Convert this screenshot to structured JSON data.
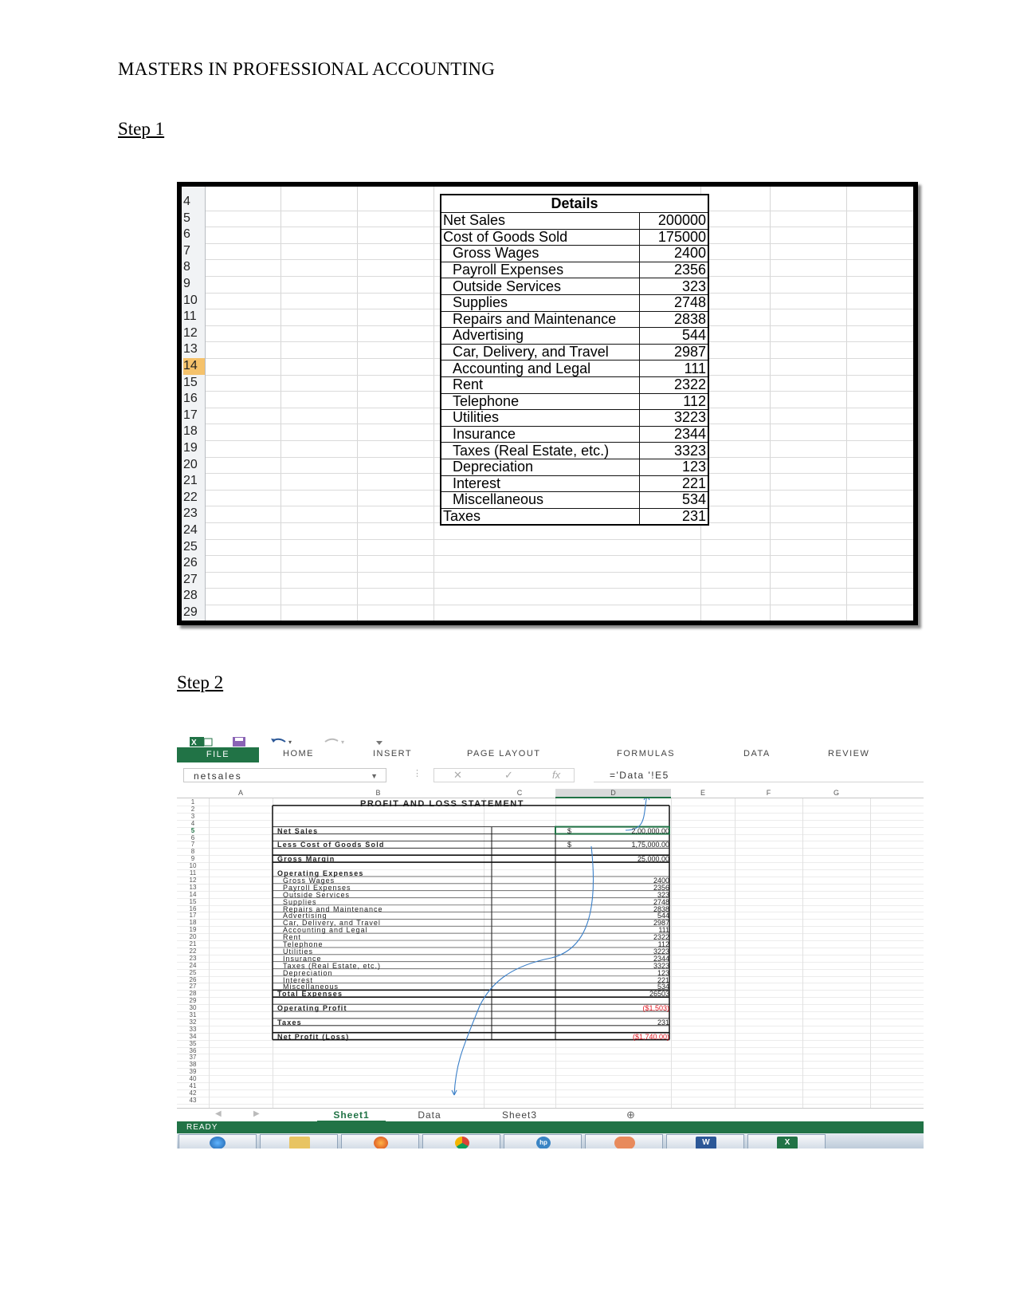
{
  "document": {
    "header": "MASTERS IN PROFESSIONAL ACCOUNTING",
    "step1_label": "Step 1",
    "step2_label": "Step 2"
  },
  "screenshot1": {
    "row_numbers": [
      "4",
      "5",
      "6",
      "7",
      "8",
      "9",
      "10",
      "11",
      "12",
      "13",
      "14",
      "15",
      "16",
      "17",
      "18",
      "19",
      "20",
      "21",
      "22",
      "23",
      "24",
      "25",
      "26",
      "27",
      "28",
      "29"
    ],
    "selected_row": "14",
    "table_header": "Details",
    "rows": [
      {
        "label": "Net Sales",
        "value": "200000",
        "indent": false
      },
      {
        "label": "Cost of Goods Sold",
        "value": "175000",
        "indent": false
      },
      {
        "label": "Gross Wages",
        "value": "2400",
        "indent": true
      },
      {
        "label": "Payroll Expenses",
        "value": "2356",
        "indent": true
      },
      {
        "label": "Outside Services",
        "value": "323",
        "indent": true
      },
      {
        "label": "Supplies",
        "value": "2748",
        "indent": true
      },
      {
        "label": "Repairs and Maintenance",
        "value": "2838",
        "indent": true
      },
      {
        "label": "Advertising",
        "value": "544",
        "indent": true
      },
      {
        "label": "Car, Delivery, and Travel",
        "value": "2987",
        "indent": true
      },
      {
        "label": "Accounting and Legal",
        "value": "111",
        "indent": true
      },
      {
        "label": "Rent",
        "value": "2322",
        "indent": true
      },
      {
        "label": "Telephone",
        "value": "112",
        "indent": true
      },
      {
        "label": "Utilities",
        "value": "3223",
        "indent": true
      },
      {
        "label": "Insurance",
        "value": "2344",
        "indent": true
      },
      {
        "label": "Taxes (Real Estate, etc.)",
        "value": "3323",
        "indent": true
      },
      {
        "label": "Depreciation",
        "value": "123",
        "indent": true
      },
      {
        "label": "Interest",
        "value": "221",
        "indent": true
      },
      {
        "label": "Miscellaneous",
        "value": "534",
        "indent": true
      },
      {
        "label": "Taxes",
        "value": "231",
        "indent": false
      }
    ]
  },
  "screenshot2": {
    "ribbon_tabs": [
      "FILE",
      "HOME",
      "INSERT",
      "PAGE LAYOUT",
      "FORMULAS",
      "DATA",
      "REVIEW"
    ],
    "name_box": "netsales",
    "formula": "='Data '!E5",
    "fx_symbol": "fx",
    "columns": [
      "A",
      "B",
      "C",
      "D",
      "E",
      "F",
      "G"
    ],
    "selected_column": "D",
    "title": "PROFIT AND LOSS STATEMENT",
    "net_sales": {
      "label": "Net Sales",
      "currency": "$",
      "value": "2,00,000.00"
    },
    "cogs": {
      "label": "Less Cost of Goods Sold",
      "currency": "$",
      "value": "1,75,000.00"
    },
    "gross_margin": {
      "label": "Gross Margin",
      "value": "25,000.00"
    },
    "opex_heading": "Operating Expenses",
    "expenses": [
      {
        "label": "Gross Wages",
        "value": "2400"
      },
      {
        "label": "Payroll Expenses",
        "value": "2356"
      },
      {
        "label": "Outside Services",
        "value": "323"
      },
      {
        "label": "Supplies",
        "value": "2748"
      },
      {
        "label": "Repairs and Maintenance",
        "value": "2838"
      },
      {
        "label": "Advertising",
        "value": "544"
      },
      {
        "label": "Car, Delivery, and Travel",
        "value": "2987"
      },
      {
        "label": "Accounting and Legal",
        "value": "111"
      },
      {
        "label": "Rent",
        "value": "2322"
      },
      {
        "label": "Telephone",
        "value": "112"
      },
      {
        "label": "Utilities",
        "value": "3223"
      },
      {
        "label": "Insurance",
        "value": "2344"
      },
      {
        "label": "Taxes (Real Estate, etc.)",
        "value": "3323"
      },
      {
        "label": "Depreciation",
        "value": "123"
      },
      {
        "label": "Interest",
        "value": "221"
      },
      {
        "label": "Miscellaneous",
        "value": "534"
      }
    ],
    "total_expenses": {
      "label": "Total Expenses",
      "value": "26503"
    },
    "operating_profit": {
      "label": "Operating Profit",
      "value": "($1,503)"
    },
    "taxes": {
      "label": "Taxes",
      "value": "231"
    },
    "net_profit": {
      "label": "Net Profit (Loss)",
      "value": "($1,740.00)"
    },
    "sheet_tabs": [
      "Sheet1",
      "Data",
      "Sheet3"
    ],
    "active_sheet": "Sheet1",
    "status": "READY",
    "accent_color": "#217346",
    "negative_color": "#e0141e",
    "taskbar_icons": [
      "windows-start-icon",
      "folder-icon",
      "firefox-icon",
      "chrome-icon",
      "hp-icon",
      "media-icon",
      "word-icon",
      "excel-icon"
    ]
  }
}
